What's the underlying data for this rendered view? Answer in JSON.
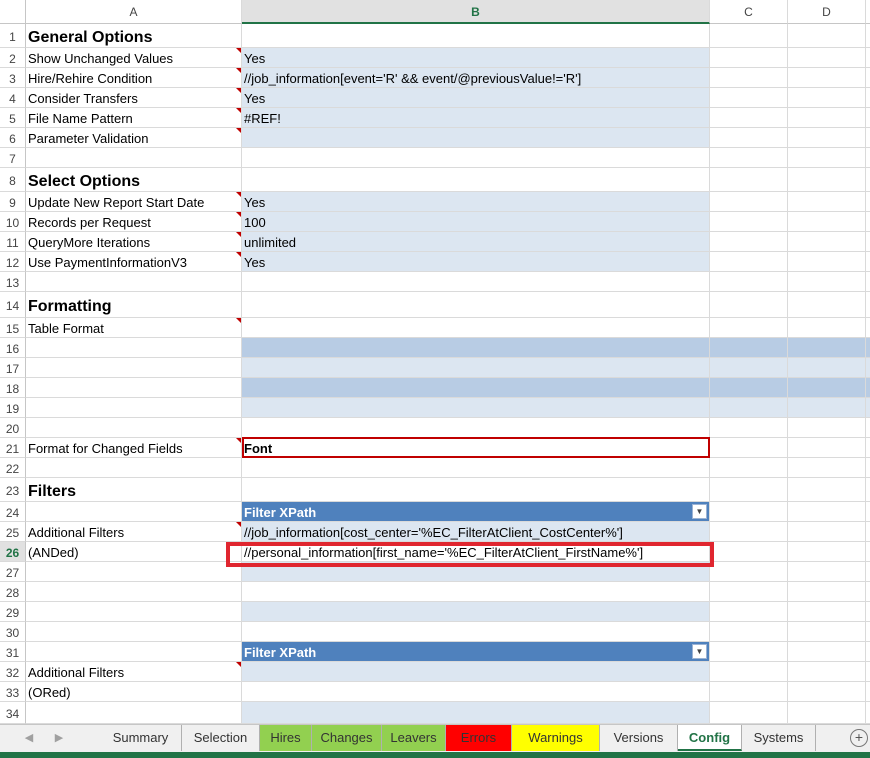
{
  "columns": [
    "A",
    "B",
    "C",
    "D"
  ],
  "selected_row": "26",
  "rows": {
    "r1": {
      "num": "1",
      "a": "General Options"
    },
    "r2": {
      "num": "2",
      "a": "Show Unchanged Values",
      "b": "Yes"
    },
    "r3": {
      "num": "3",
      "a": "Hire/Rehire Condition",
      "b": "//job_information[event='R' && event/@previousValue!='R']"
    },
    "r4": {
      "num": "4",
      "a": "Consider Transfers",
      "b": "Yes"
    },
    "r5": {
      "num": "5",
      "a": "File Name Pattern",
      "b": "#REF!"
    },
    "r6": {
      "num": "6",
      "a": "Parameter Validation",
      "b": ""
    },
    "r7": {
      "num": "7"
    },
    "r8": {
      "num": "8",
      "a": "Select Options"
    },
    "r9": {
      "num": "9",
      "a": "Update New Report Start Date",
      "b": "Yes"
    },
    "r10": {
      "num": "10",
      "a": "Records per Request",
      "b": "100"
    },
    "r11": {
      "num": "11",
      "a": "QueryMore Iterations",
      "b": "unlimited"
    },
    "r12": {
      "num": "12",
      "a": "Use PaymentInformationV3",
      "b": "Yes"
    },
    "r13": {
      "num": "13"
    },
    "r14": {
      "num": "14",
      "a": "Formatting"
    },
    "r15": {
      "num": "15",
      "a": "Table Format"
    },
    "r16": {
      "num": "16"
    },
    "r17": {
      "num": "17"
    },
    "r18": {
      "num": "18"
    },
    "r19": {
      "num": "19"
    },
    "r20": {
      "num": "20"
    },
    "r21": {
      "num": "21",
      "a": "Format for Changed Fields",
      "b": "Font"
    },
    "r22": {
      "num": "22"
    },
    "r23": {
      "num": "23",
      "a": "Filters"
    },
    "r24": {
      "num": "24",
      "b": "Filter XPath"
    },
    "r25": {
      "num": "25",
      "a": "Additional Filters",
      "b": "//job_information[cost_center='%EC_FilterAtClient_CostCenter%']"
    },
    "r26": {
      "num": "26",
      "a": "(ANDed)",
      "b": "//personal_information[first_name='%EC_FilterAtClient_FirstName%']"
    },
    "r27": {
      "num": "27"
    },
    "r28": {
      "num": "28"
    },
    "r29": {
      "num": "29"
    },
    "r30": {
      "num": "30"
    },
    "r31": {
      "num": "31",
      "b": "Filter XPath"
    },
    "r32": {
      "num": "32",
      "a": "Additional Filters"
    },
    "r33": {
      "num": "33",
      "a": "(ORed)"
    },
    "r34": {
      "num": "34"
    }
  },
  "sheet_tabs": [
    {
      "label": "Summary",
      "color": "#f0f0f0"
    },
    {
      "label": "Selection",
      "color": "#f0f0f0"
    },
    {
      "label": "Hires",
      "color": "#92d050"
    },
    {
      "label": "Changes",
      "color": "#92d050"
    },
    {
      "label": "Leavers",
      "color": "#92d050"
    },
    {
      "label": "Errors",
      "color": "#ff0000"
    },
    {
      "label": "Warnings",
      "color": "#ffff00"
    },
    {
      "label": "Versions",
      "color": "#f0f0f0"
    },
    {
      "label": "Config",
      "color": "#ffffff",
      "active": true
    },
    {
      "label": "Systems",
      "color": "#f0f0f0"
    }
  ],
  "colors": {
    "accent": "#217346",
    "table_header": "#4f81bd",
    "band_fill": "#dce6f1",
    "highlight_red": "#e0262f"
  }
}
